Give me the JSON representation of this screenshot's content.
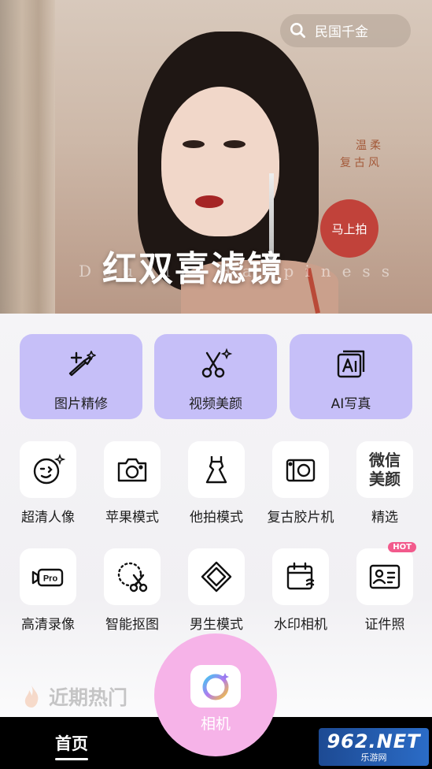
{
  "search": {
    "text": "民国千金"
  },
  "banner": {
    "side_line1": "温柔",
    "side_line2": "复古风",
    "badge": "马上拍",
    "title": "红双喜滤镜",
    "subtitle": "Double Happiness"
  },
  "big_cards": [
    {
      "label": "图片精修",
      "icon": "makeup-brush-icon"
    },
    {
      "label": "视频美颜",
      "icon": "scissors-sparkle-icon"
    },
    {
      "label": "AI写真",
      "icon": "ai-portrait-icon"
    }
  ],
  "tools_row1": [
    {
      "label": "超清人像",
      "icon": "wink-face-icon"
    },
    {
      "label": "苹果模式",
      "icon": "camera-icon"
    },
    {
      "label": "他拍模式",
      "icon": "dress-icon"
    },
    {
      "label": "复古胶片机",
      "icon": "film-camera-icon"
    },
    {
      "label": "精选",
      "icon": "weixin-beauty-icon",
      "tile_text_1": "微信",
      "tile_text_2": "美颜"
    }
  ],
  "tools_row2": [
    {
      "label": "高清录像",
      "icon": "pro-video-icon",
      "tile_text": "Pro"
    },
    {
      "label": "智能抠图",
      "icon": "smart-cutout-icon"
    },
    {
      "label": "男生模式",
      "icon": "diamond-icon"
    },
    {
      "label": "水印相机",
      "icon": "calendar-watermark-icon"
    },
    {
      "label": "证件照",
      "icon": "id-card-icon",
      "badge": "HOT"
    }
  ],
  "section": {
    "title": "近期热门"
  },
  "bottom_nav": {
    "home": "首页",
    "camera": "相机"
  },
  "watermark": {
    "line1": "962.NET",
    "line2": "乐游网"
  },
  "colors": {
    "card_purple": "#c6bff8",
    "camera_pink": "#f6b3e8",
    "hot_pink": "#f25a8c",
    "badge_red": "#c1423a"
  }
}
